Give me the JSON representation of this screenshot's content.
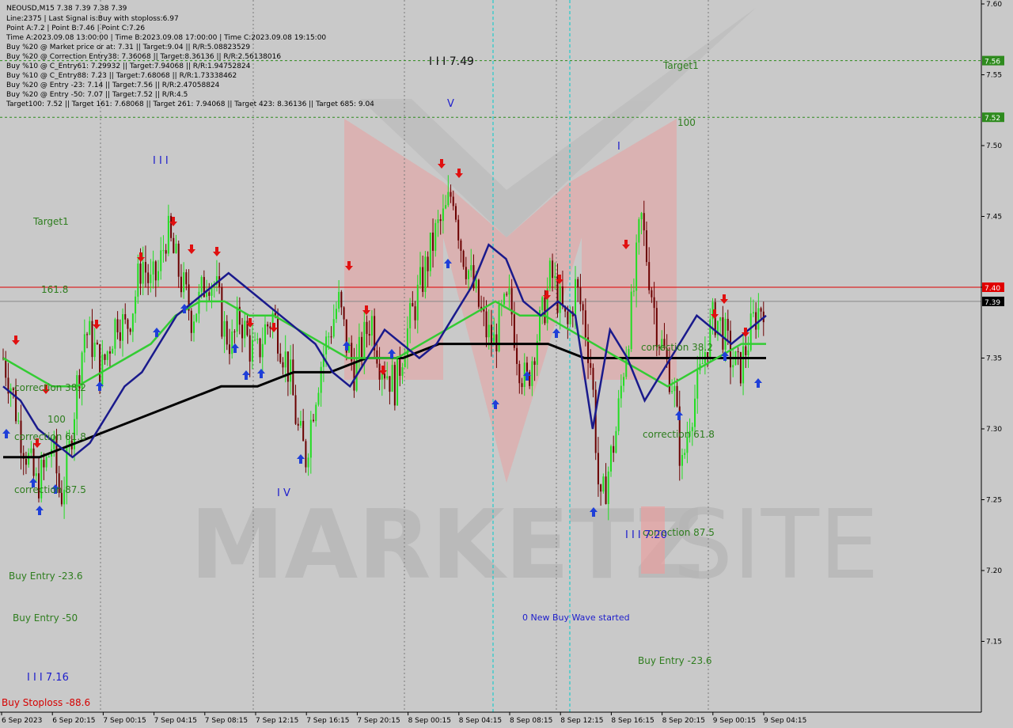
{
  "header": {
    "symbol_line": "NEOUSD,M15  7.38 7.39 7.38 7.39",
    "info_lines": [
      "Line:2375 | Last Signal is:Buy with stoploss:6.97",
      "Point A:7.2 | Point B:7.46 | Point C:7.26",
      "Time A:2023.09.08 13:00:00 | Time B:2023.09.08 17:00:00 | Time C:2023.09.08 19:15:00",
      "Buy %20 @ Market price or at: 7.31 || Target:9.04 || R/R:5.08823529",
      "Buy %20 @ Correction Entry38: 7.36068 || Target:8.36136 || R/R:2.56138016",
      "Buy %10 @ C_Entry61: 7.29932 || Target:7.94068 || R/R:1.94752824",
      "Buy %10 @ C_Entry88: 7.23 || Target:7.68068 || R/R:1.73338462",
      "Buy %20 @ Entry -23: 7.14 || Target:7.56 || R/R:2.47058824",
      "Buy %20 @ Entry -50: 7.07 || Target:7.52 || R/R:4.5",
      "Target100: 7.52 || Target 161: 7.68068 || Target 261: 7.94068 || Target 423: 8.36136 || Target 685: 9.04"
    ]
  },
  "watermark": {
    "text_left": "MARKETZ",
    "text_right": "SITE"
  },
  "price_axis": {
    "ticks": [
      "7.60",
      "7.55",
      "7.50",
      "7.45",
      "7.40",
      "7.35",
      "7.30",
      "7.25",
      "7.20",
      "7.15"
    ],
    "badges": [
      {
        "text": "7.56",
        "price": 7.56,
        "bg": "#2e8b1e",
        "fg": "#ffffff"
      },
      {
        "text": "7.52",
        "price": 7.52,
        "bg": "#2e8b1e",
        "fg": "#ffffff"
      },
      {
        "text": "7.40",
        "price": 7.4,
        "bg": "#e00000",
        "fg": "#ffffff"
      },
      {
        "text": "7.39",
        "price": 7.39,
        "bg": "#000000",
        "fg": "#ffffff"
      }
    ]
  },
  "time_axis": {
    "labels": [
      "6 Sep 2023",
      "6 Sep 20:15",
      "7 Sep 00:15",
      "7 Sep 04:15",
      "7 Sep 08:15",
      "7 Sep 12:15",
      "7 Sep 16:15",
      "7 Sep 20:15",
      "8 Sep 00:15",
      "8 Sep 04:15",
      "8 Sep 08:15",
      "8 Sep 12:15",
      "8 Sep 16:15",
      "8 Sep 20:15",
      "9 Sep 00:15",
      "9 Sep 04:15"
    ]
  },
  "annotations": {
    "target1_left": "Target1",
    "fib_161": "161.8",
    "correction_382_left": "correction 38.2",
    "fib_100_left": "100",
    "correction_618_left": "correction 61.8",
    "correction_875_left": "correction 87.5",
    "buy_entry_236_left": "Buy Entry -23.6",
    "buy_entry_50_left": "Buy Entry -50",
    "wave_716": "I I I 7.16",
    "buy_stoploss": "Buy Stoploss -88.6",
    "wave_III": "I I I",
    "wave_IV": "I V",
    "wave_749": "I I I 7.49",
    "wave_V": "V",
    "wave_I": "I",
    "target1_right": "Target1",
    "fib_100_right": "100",
    "correction_382_right": "correction 38.2",
    "correction_618_right": "correction 61.8",
    "correction_875_right": "correction 87.5",
    "wave_720": "I I I 7.20",
    "new_buy_wave": "0 New Buy Wave started",
    "buy_entry_236_right": "Buy Entry -23.6"
  },
  "colors": {
    "background": "#c9c9c9",
    "bull_candle": "#22dd22",
    "bear_candle": "#6b0000",
    "ma_fast": "#1a1a8c",
    "ma_mid": "#33cc33",
    "ma_slow": "#000000",
    "target_line": "#2e8b1e",
    "signal_line": "#e00000",
    "buy_arrow": "#1f3fd8",
    "sell_arrow": "#e01010"
  },
  "chart_data": {
    "type": "candlestick",
    "symbol": "NEOUSD",
    "timeframe": "M15",
    "ylim": [
      7.1,
      7.6
    ],
    "x_ticks": [
      "6 Sep 2023",
      "6 Sep 20:15",
      "7 Sep 00:15",
      "7 Sep 04:15",
      "7 Sep 08:15",
      "7 Sep 12:15",
      "7 Sep 16:15",
      "7 Sep 20:15",
      "8 Sep 00:15",
      "8 Sep 04:15",
      "8 Sep 08:15",
      "8 Sep 12:15",
      "8 Sep 16:15",
      "8 Sep 20:15",
      "9 Sep 00:15",
      "9 Sep 04:15"
    ],
    "y_ticks": [
      7.6,
      7.55,
      7.5,
      7.45,
      7.4,
      7.35,
      7.3,
      7.25,
      7.2,
      7.15
    ],
    "horizontal_lines": [
      {
        "price": 7.56,
        "color": "#2e8b1e",
        "style": "dashed"
      },
      {
        "price": 7.52,
        "color": "#2e8b1e",
        "style": "dashed"
      },
      {
        "price": 7.4,
        "color": "#e00000",
        "style": "solid"
      },
      {
        "price": 7.39,
        "color": "#888888",
        "style": "solid"
      }
    ],
    "close_path": [
      7.35,
      7.33,
      7.3,
      7.28,
      7.26,
      7.27,
      7.29,
      7.25,
      7.28,
      7.33,
      7.37,
      7.36,
      7.34,
      7.36,
      7.38,
      7.37,
      7.39,
      7.42,
      7.4,
      7.41,
      7.44,
      7.42,
      7.4,
      7.38,
      7.39,
      7.41,
      7.4,
      7.37,
      7.36,
      7.38,
      7.36,
      7.35,
      7.37,
      7.38,
      7.36,
      7.34,
      7.3,
      7.28,
      7.32,
      7.35,
      7.37,
      7.39,
      7.36,
      7.34,
      7.36,
      7.38,
      7.35,
      7.34,
      7.33,
      7.36,
      7.38,
      7.4,
      7.42,
      7.44,
      7.45,
      7.47,
      7.43,
      7.41,
      7.39,
      7.37,
      7.36,
      7.38,
      7.39,
      7.35,
      7.33,
      7.36,
      7.38,
      7.41,
      7.39,
      7.37,
      7.4,
      7.38,
      7.34,
      7.24,
      7.27,
      7.3,
      7.35,
      7.39,
      7.45,
      7.41,
      7.37,
      7.35,
      7.33,
      7.27,
      7.31,
      7.33,
      7.36,
      7.38,
      7.37,
      7.35,
      7.34,
      7.36,
      7.38,
      7.39
    ],
    "ma_fast": [
      7.33,
      7.32,
      7.3,
      7.29,
      7.28,
      7.29,
      7.31,
      7.33,
      7.34,
      7.36,
      7.38,
      7.39,
      7.4,
      7.41,
      7.4,
      7.39,
      7.38,
      7.37,
      7.36,
      7.34,
      7.33,
      7.35,
      7.37,
      7.36,
      7.35,
      7.36,
      7.38,
      7.4,
      7.43,
      7.42,
      7.39,
      7.38,
      7.39,
      7.38,
      7.3,
      7.37,
      7.35,
      7.32,
      7.34,
      7.36,
      7.38,
      7.37,
      7.36,
      7.37,
      7.38
    ],
    "ma_mid": [
      7.35,
      7.34,
      7.33,
      7.33,
      7.34,
      7.35,
      7.36,
      7.38,
      7.39,
      7.39,
      7.38,
      7.38,
      7.37,
      7.36,
      7.35,
      7.35,
      7.35,
      7.36,
      7.37,
      7.38,
      7.39,
      7.38,
      7.38,
      7.37,
      7.36,
      7.35,
      7.34,
      7.33,
      7.34,
      7.35,
      7.36,
      7.36
    ],
    "ma_slow": [
      7.28,
      7.28,
      7.29,
      7.3,
      7.31,
      7.32,
      7.33,
      7.33,
      7.34,
      7.34,
      7.35,
      7.35,
      7.36,
      7.36,
      7.36,
      7.36,
      7.35,
      7.35,
      7.35,
      7.35,
      7.35,
      7.35
    ]
  }
}
